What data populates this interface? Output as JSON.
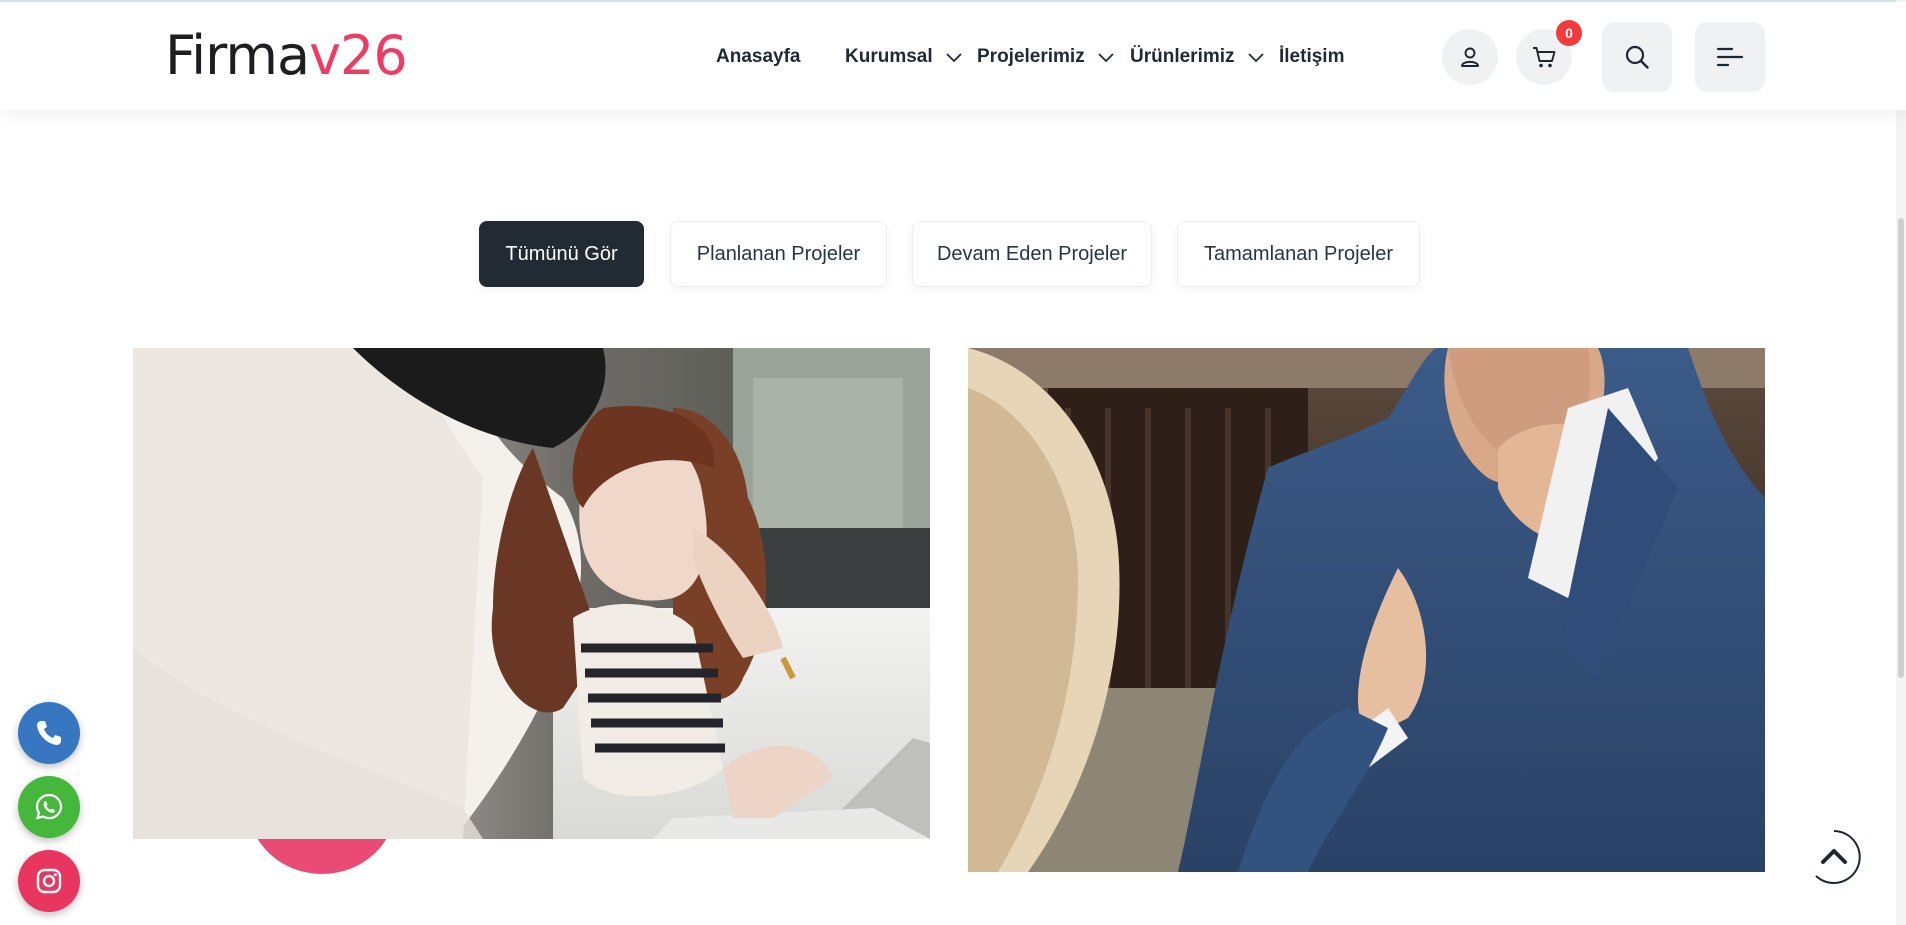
{
  "header": {
    "logo": {
      "part1": "Firma",
      "part2": "v26"
    },
    "nav": [
      {
        "label": "Anasayfa",
        "has_dropdown": false
      },
      {
        "label": "Kurumsal",
        "has_dropdown": true
      },
      {
        "label": "Projelerimiz",
        "has_dropdown": true
      },
      {
        "label": "Ürünlerimiz",
        "has_dropdown": true
      },
      {
        "label": "İletişim",
        "has_dropdown": false
      }
    ],
    "icons": {
      "account": "user-icon",
      "cart": "cart-icon",
      "search": "search-icon",
      "menu": "menu-icon"
    },
    "cart_count": "0"
  },
  "filters": [
    {
      "label": "Tümünü Gör",
      "active": true
    },
    {
      "label": "Planlanan Projeler",
      "active": false
    },
    {
      "label": "Devam Eden Projeler",
      "active": false
    },
    {
      "label": "Tamamlanan Projeler",
      "active": false
    }
  ],
  "projects": [
    {
      "image": "photo of a man and a curly-haired woman looking at a laptop"
    },
    {
      "image": "photo of a man in a blue sweater with hand on chin"
    }
  ],
  "floating_contacts": [
    {
      "icon": "phone-icon",
      "color": "#3777c2"
    },
    {
      "icon": "whatsapp-icon",
      "color": "#44b73c"
    },
    {
      "icon": "instagram-icon",
      "color": "#e8365f"
    }
  ],
  "colors": {
    "brand_accent": "#ea3f63",
    "dark": "#222b33",
    "badge": "#f33a3f"
  }
}
